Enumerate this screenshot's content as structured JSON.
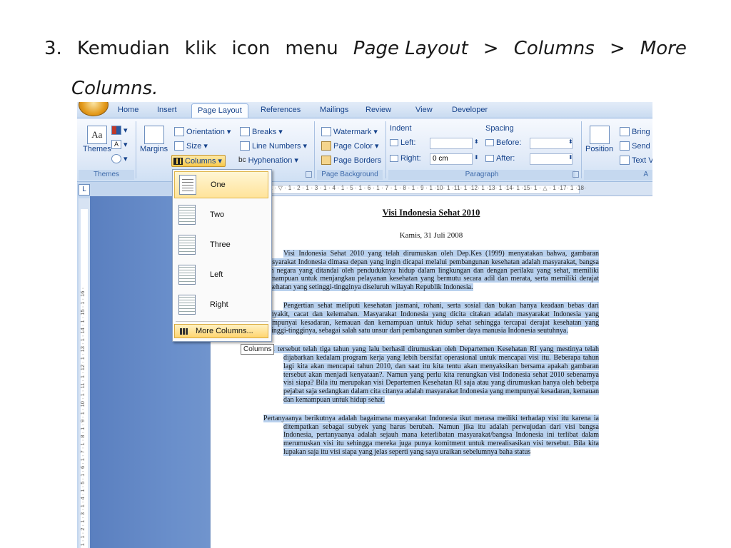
{
  "instruction": {
    "number": "3.",
    "words": [
      "Kemudian",
      "klik",
      "icon",
      "menu"
    ],
    "path_1": "Page Layout",
    "sep": ">",
    "path_2": "Columns",
    "path_3": "More",
    "path_4": "Columns."
  },
  "tabs": [
    "Home",
    "Insert",
    "Page Layout",
    "References",
    "Mailings",
    "Review",
    "View",
    "Developer"
  ],
  "active_tab": "Page Layout",
  "ribbon": {
    "themes": {
      "button": "Themes",
      "group": "Themes"
    },
    "page_setup": {
      "margins": "Margins",
      "orientation": "Orientation",
      "size": "Size",
      "columns": "Columns",
      "breaks": "Breaks",
      "line_numbers": "Line Numbers",
      "hyphenation": "Hyphenation"
    },
    "page_background": {
      "watermark": "Watermark",
      "page_color": "Page Color",
      "page_borders": "Page Borders",
      "group": "Page Background"
    },
    "paragraph": {
      "indent": "Indent",
      "left": "Left:",
      "left_value": "",
      "right": "Right:",
      "right_value": "0 cm",
      "spacing": "Spacing",
      "before": "Before:",
      "before_value": "",
      "after": "After:",
      "after_value": "",
      "group": "Paragraph"
    },
    "arrange": {
      "position": "Position",
      "bring": "Bring",
      "send": "Send",
      "text_wrap": "Text V",
      "group_partial": "A"
    }
  },
  "ruler": {
    "corner": "L",
    "ticks": "· 1 · ▽ · 1 · 2 · 1 · 3 · 1 · 4 · 1 · 5 · 1 · 6 · 1 · 7 · 1 · 8 · 1 · 9 · 1 ·10· 1 ·11· 1 ·12· 1 ·13· 1 ·14· 1 ·15· 1 · △ · 1 ·17· 1 ·18·",
    "vticks": "· 1 · 1 · 2 · 1 · 3 · 1 · 4 · 1 · 5 · 1 · 6 · 1 · 7 · 1 · 8 · 1 · 9 · 1 · 10 · 1 · 11 · 1 · 12 · 1 · 13 · 1 · 14 · 1 · 15 · 1 · 16 ·"
  },
  "columns_menu": {
    "items": [
      "One",
      "Two",
      "Three",
      "Left",
      "Right"
    ],
    "more": "More Columns...",
    "tooltip": "Columns"
  },
  "document": {
    "title": "Visi Indonesia Sehat 2010",
    "date": "Kamis, 31 Juli 2008",
    "paragraphs": [
      "Visi Indonesia Sehat 2010 yang telah dirumuskan oleh Dep.Kes (1999) menyatakan bahwa, gambaran masyarakat Indonesia dimasa depan yang ingin dicapai melalui pembangunan kesehatan adalah masyarakat, bangsa dan negara yang ditandai oleh penduduknya hidup dalam lingkungan dan dengan perilaku yang sehat, memiliki kemampuan untuk menjangkau pelayanan kesehatan yang bermutu secara adil dan merata, serta memiliki derajat kesehatan yang setinggi-tingginya diseluruh wilayah Republik Indonesia.",
      "Pengertian sehat meliputi kesehatan jasmani, rohani, serta sosial dan bukan hanya keadaan bebas dari penyakit, cacat dan kelemahan. Masyarakat Indonesia yang dicita citakan adalah masyarakat Indonesia yang mempunyai kesadaran, kemauan dan kemampuan untuk hidup sehat sehingga tercapai derajat kesehatan yang setinggi-tingginya, sebagai salah satu unsur dari pembangunan sumber daya manusia Indonesia seutuhnya.",
      "Visi tersebut telah tiga tahun yang lalu berhasil dirumuskan oleh Departemen Kesehatan RI yang mestinya telah dijabarkan kedalam program kerja yang lebih bersifat operasional untuk mencapai visi itu. Beberapa tahun lagi kita akan mencapai tahun 2010, dan saat itu kita tentu akan menyaksikan bersama apakah gambaran tersebut akan menjadi kenyataan?. Namun yang perlu kita renungkan visi Indonesia sehat 2010 sebenarnya visi siapa? Bila itu merupakan visi Departemen Kesehatan RI saja atau yang dirumuskan hanya oleh beberpa pejabat saja sedangkan dalam cita citanya adalah masyarakat Indonesia yang mempunyai kesadaran, kemauan dan kemampuan untuk hidup sehat.",
      "Pertanyaanya berikutnya adalah bagaimana masyarakat Indonesia ikut merasa meiliki terhadap visi itu karena ia ditempatkan sebagai subyek yang harus berubah. Namun jika itu adalah perwujudan dari visi bangsa Indonesia, pertanyaanya adalah sejauh mana keterlibatan masyarakat/bangsa Indonesia ini terlibat dalam merumuskan visi itu sehingga mereka juga punya komitment untuk merealisasikan visi tersebut. Bila kita lupakan saja itu visi siapa yang jelas seperti yang saya uraikan sebelumnya baha status"
    ]
  }
}
